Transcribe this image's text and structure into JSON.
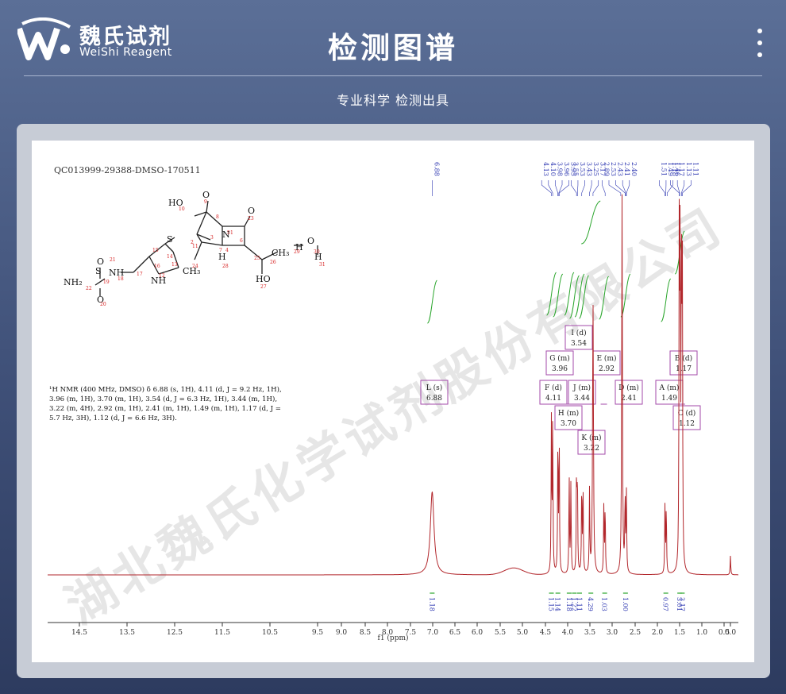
{
  "header": {
    "brand_cn": "魏氏试剂",
    "brand_en": "WeiShi Reagent",
    "title": "检测图谱",
    "subtitle": "专业科学  检测出具"
  },
  "colors": {
    "accent": "#b2272c",
    "integral": "#29a52b",
    "peak_label": "#2b35b0",
    "multiplet_box": "#a34aa9",
    "watermark": "#c7c7c7"
  },
  "watermark": "湖北魏氏化学试剂股份有限公司",
  "chart_data": {
    "type": "line",
    "title": "QC013999-29388-DMSO-170511",
    "xlabel": "f1 (ppm)",
    "xlim": [
      14.8,
      -0.2
    ],
    "x_reversed": true,
    "x_ticks": [
      "14.5",
      "13.5",
      "12.5",
      "11.5",
      "10.5",
      "9.5",
      "9.0",
      "8.5",
      "8.0",
      "7.5",
      "7.0",
      "6.5",
      "6.0",
      "5.5",
      "5.0",
      "4.5",
      "4.0",
      "3.5",
      "3.0",
      "2.5",
      "2.0",
      "1.5",
      "1.0",
      "0.5",
      "0.0"
    ],
    "peak_labels": [
      "6.88",
      "4.13",
      "4.10",
      "3.98",
      "3.96",
      "3.95",
      "3.55",
      "3.53",
      "3.43",
      "3.25",
      "3.17",
      "2.89",
      "2.53",
      "2.43",
      "2.41",
      "2.40",
      "1.51",
      "1.49",
      "1.46",
      "1.18",
      "1.17",
      "1.13",
      "1.11"
    ],
    "nmr_text": "¹H NMR (400 MHz, DMSO) δ 6.88 (s, 1H), 4.11 (d, J = 9.2 Hz, 1H), 3.96 (m, 1H), 3.70 (m, 1H), 3.54 (d, J = 6.3 Hz, 1H), 3.44 (m, 1H), 3.22 (m, 4H), 2.92 (m, 1H), 2.41 (m, 1H), 1.49 (m, 1H), 1.17 (d, J = 5.7 Hz, 3H), 1.12 (d, J = 6.6 Hz, 3H).",
    "multiplets": [
      {
        "letter": "L",
        "type": "(s)",
        "shift": "6.88"
      },
      {
        "letter": "F",
        "type": "(d)",
        "shift": "4.11"
      },
      {
        "letter": "G",
        "type": "(m)",
        "shift": "3.96"
      },
      {
        "letter": "H",
        "type": "(m)",
        "shift": "3.70"
      },
      {
        "letter": "I",
        "type": "(d)",
        "shift": "3.54"
      },
      {
        "letter": "J",
        "type": "(m)",
        "shift": "3.44"
      },
      {
        "letter": "K",
        "type": "(m)",
        "shift": "3.22"
      },
      {
        "letter": "E",
        "type": "(m)",
        "shift": "2.92"
      },
      {
        "letter": "D",
        "type": "(m)",
        "shift": "2.41"
      },
      {
        "letter": "A",
        "type": "(m)",
        "shift": "1.49"
      },
      {
        "letter": "B",
        "type": "(d)",
        "shift": "1.17"
      },
      {
        "letter": "C",
        "type": "(d)",
        "shift": "1.12"
      }
    ],
    "integrals": [
      {
        "x": 6.88,
        "value": "1.18"
      },
      {
        "x": 4.13,
        "value": "1.15"
      },
      {
        "x": 3.98,
        "value": "1.14"
      },
      {
        "x": 3.72,
        "value": "1.18"
      },
      {
        "x": 3.6,
        "value": "1.22"
      },
      {
        "x": 3.48,
        "value": "1.11"
      },
      {
        "x": 3.22,
        "value": "4.29"
      },
      {
        "x": 2.9,
        "value": "1.03"
      },
      {
        "x": 2.42,
        "value": "1.00"
      },
      {
        "x": 1.49,
        "value": "0.97"
      },
      {
        "x": 1.17,
        "value": "3.01"
      },
      {
        "x": 1.11,
        "value": "3.17"
      }
    ],
    "peaks": [
      {
        "x": 6.88,
        "h": 0.22,
        "w": 0.05
      },
      {
        "x": 4.13,
        "h": 0.4,
        "w": 0.008
      },
      {
        "x": 4.1,
        "h": 0.41,
        "w": 0.008
      },
      {
        "x": 3.98,
        "h": 0.36,
        "w": 0.008
      },
      {
        "x": 3.95,
        "h": 0.36,
        "w": 0.008
      },
      {
        "x": 3.72,
        "h": 0.26,
        "w": 0.008
      },
      {
        "x": 3.68,
        "h": 0.24,
        "w": 0.008
      },
      {
        "x": 3.55,
        "h": 0.26,
        "w": 0.008
      },
      {
        "x": 3.53,
        "h": 0.25,
        "w": 0.008
      },
      {
        "x": 3.43,
        "h": 0.24,
        "w": 0.008
      },
      {
        "x": 3.4,
        "h": 0.22,
        "w": 0.008
      },
      {
        "x": 3.25,
        "h": 0.22,
        "w": 0.008
      },
      {
        "x": 3.17,
        "h": 0.72,
        "w": 0.012
      },
      {
        "x": 2.92,
        "h": 0.18,
        "w": 0.008
      },
      {
        "x": 2.89,
        "h": 0.18,
        "w": 0.008
      },
      {
        "x": 2.5,
        "h": 1.0,
        "w": 0.01
      },
      {
        "x": 2.43,
        "h": 0.2,
        "w": 0.008
      },
      {
        "x": 2.4,
        "h": 0.21,
        "w": 0.008
      },
      {
        "x": 1.51,
        "h": 0.18,
        "w": 0.008
      },
      {
        "x": 1.48,
        "h": 0.18,
        "w": 0.008
      },
      {
        "x": 1.18,
        "h": 0.88,
        "w": 0.008
      },
      {
        "x": 1.16,
        "h": 0.86,
        "w": 0.008
      },
      {
        "x": 1.13,
        "h": 0.82,
        "w": 0.008
      },
      {
        "x": 1.11,
        "h": 0.8,
        "w": 0.008
      },
      {
        "x": 0.0,
        "h": 0.05,
        "w": 0.008
      }
    ],
    "molecule": {
      "atoms": [
        "HO",
        "O",
        "S",
        "N",
        "O",
        "H",
        "O",
        "H",
        "H",
        "H",
        "HO",
        "S",
        "NH",
        "NH",
        "NH₂",
        "O",
        "O",
        "CH₃",
        "CH₃"
      ],
      "indices": [
        "10",
        "9",
        "2",
        "1",
        "23",
        "3",
        "11",
        "7",
        "6",
        "5",
        "4",
        "25",
        "26",
        "14",
        "15",
        "13",
        "16",
        "12",
        "17",
        "18",
        "19",
        "21",
        "22",
        "20",
        "24",
        "28",
        "27",
        "29",
        "30",
        "31",
        "8"
      ]
    }
  }
}
